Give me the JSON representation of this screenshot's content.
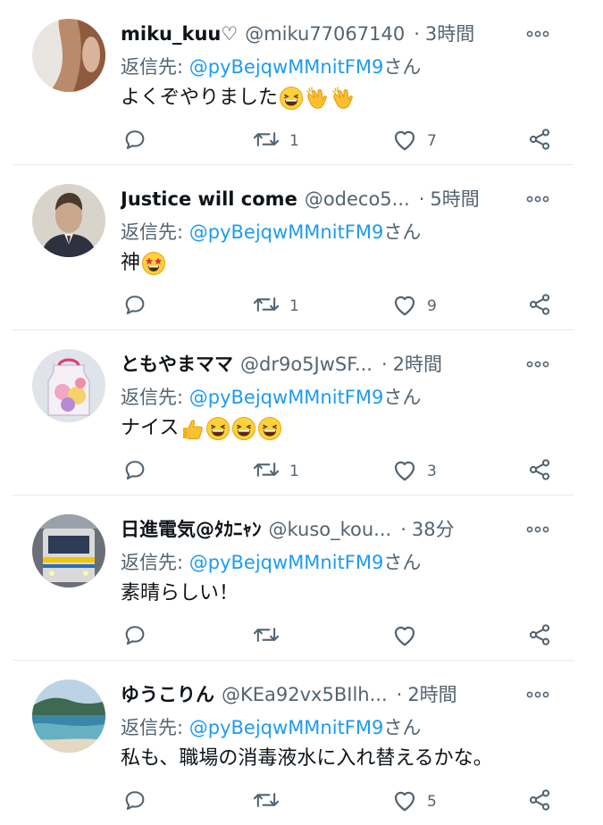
{
  "tweets": [
    {
      "name": "miku_kuu♡",
      "handle": "@miku77067140",
      "time": "3時間",
      "reply_prefix": "返信先: ",
      "reply_mention": "@pyBejqwMMnitFM9",
      "reply_suffix": "さん",
      "text": "よくぞやりました",
      "emojis": [
        "grin",
        "clap",
        "clap"
      ],
      "retweets": "1",
      "likes": "7",
      "avatar": "hair-photo"
    },
    {
      "name": "Justice will come",
      "handle": "@odeco5...",
      "time": "5時間",
      "reply_prefix": "返信先: ",
      "reply_mention": "@pyBejqwMMnitFM9",
      "reply_suffix": "さん",
      "text": "神",
      "emojis": [
        "star-struck"
      ],
      "retweets": "1",
      "likes": "9",
      "avatar": "portrait-photo"
    },
    {
      "name": "ともやまママ",
      "handle": "@dr9o5JwSF...",
      "time": "2時間",
      "reply_prefix": "返信先: ",
      "reply_mention": "@pyBejqwMMnitFM9",
      "reply_suffix": "さん",
      "text": "ナイス",
      "emojis": [
        "thumbs-up",
        "grin",
        "grin",
        "grin"
      ],
      "retweets": "1",
      "likes": "3",
      "avatar": "flower-jar-photo"
    },
    {
      "name": "日進電気@ﾀｶﾆｬﾝ",
      "handle": "@kuso_kou...",
      "time": "38分",
      "reply_prefix": "返信先: ",
      "reply_mention": "@pyBejqwMMnitFM9",
      "reply_suffix": "さん",
      "text": "素晴らしい！",
      "emojis": [],
      "retweets": "",
      "likes": "",
      "avatar": "train-photo"
    },
    {
      "name": "ゆうこりん",
      "handle": "@KEa92vx5BIlh...",
      "time": "2時間",
      "reply_prefix": "返信先: ",
      "reply_mention": "@pyBejqwMMnitFM9",
      "reply_suffix": "さん",
      "text": "私も、職場の消毒液水に入れ替えるかな。",
      "emojis": [],
      "retweets": "",
      "likes": "5",
      "avatar": "seaside-photo"
    }
  ],
  "separator": "·",
  "colors": {
    "text": "#0f1419",
    "secondary": "#536471",
    "link": "#1d9bf0",
    "divider": "#e6ecf0"
  }
}
